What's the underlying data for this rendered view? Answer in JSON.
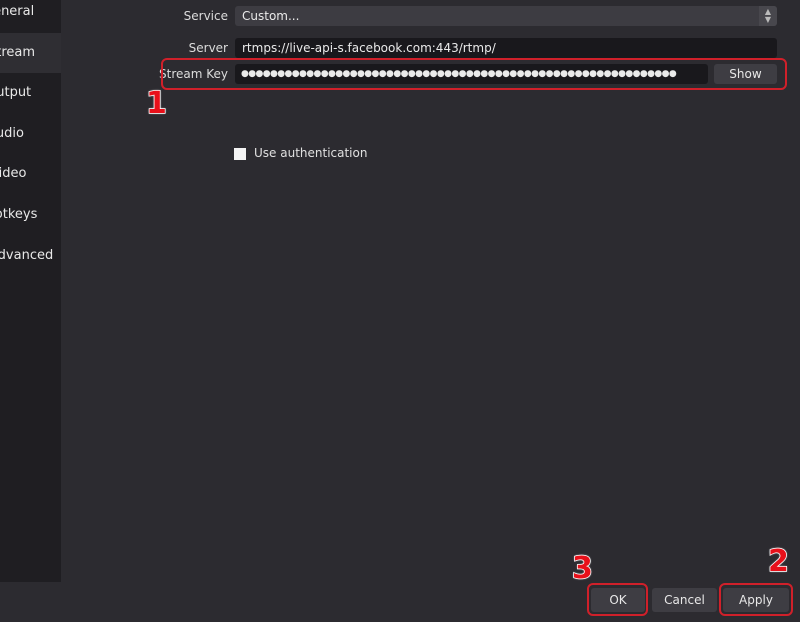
{
  "sidebar": {
    "items": [
      {
        "label": "General"
      },
      {
        "label": "Stream",
        "selected": true
      },
      {
        "label": "Output"
      },
      {
        "label": "Audio"
      },
      {
        "label": "Video"
      },
      {
        "label": "Hotkeys"
      },
      {
        "label": "Advanced"
      }
    ]
  },
  "stream": {
    "service_label": "Service",
    "service_value": "Custom...",
    "server_label": "Server",
    "server_value": "rtmps://live-api-s.facebook.com:443/rtmp/",
    "key_label": "Stream Key",
    "key_value": "●●●●●●●●●●●●●●●●●●●●●●●●●●●●●●●●●●●●●●●●●●●●●●●●●●●●●●●●●●●●",
    "show_label": "Show",
    "auth_label": "Use authentication",
    "auth_checked": false
  },
  "footer": {
    "ok": "OK",
    "cancel": "Cancel",
    "apply": "Apply"
  },
  "annotations": {
    "one": "1",
    "two": "2",
    "three": "3",
    "color": "#d0202a"
  }
}
